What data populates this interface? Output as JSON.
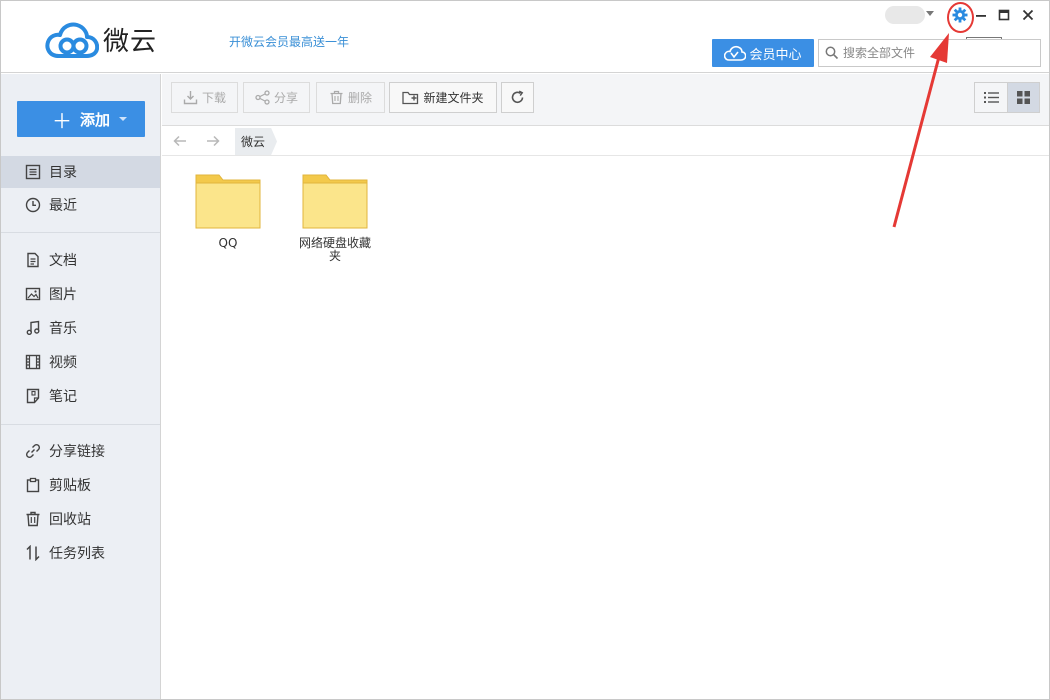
{
  "app": {
    "name": "微云",
    "promo": "开微云会员最高送一年"
  },
  "header": {
    "vip_label": "会员中心",
    "search_placeholder": "搜索全部文件",
    "settings_tooltip": "设置"
  },
  "sidebar": {
    "add_label": "添加",
    "items": [
      {
        "label": "目录",
        "icon": "list-icon",
        "active": true
      },
      {
        "label": "最近",
        "icon": "clock-icon"
      },
      {
        "label": "文档",
        "icon": "document-icon"
      },
      {
        "label": "图片",
        "icon": "image-icon"
      },
      {
        "label": "音乐",
        "icon": "music-icon"
      },
      {
        "label": "视频",
        "icon": "film-icon"
      },
      {
        "label": "笔记",
        "icon": "note-icon"
      },
      {
        "label": "分享链接",
        "icon": "link-icon"
      },
      {
        "label": "剪贴板",
        "icon": "clipboard-icon"
      },
      {
        "label": "回收站",
        "icon": "trash-icon"
      },
      {
        "label": "任务列表",
        "icon": "transfer-icon"
      }
    ]
  },
  "toolbar": {
    "download": "下载",
    "share": "分享",
    "delete": "删除",
    "new_folder": "新建文件夹"
  },
  "breadcrumb": {
    "current": "微云"
  },
  "files": [
    {
      "name": "QQ",
      "type": "folder"
    },
    {
      "name": "网络硬盘收藏夹",
      "type": "folder"
    }
  ],
  "colors": {
    "accent": "#3b8fe4",
    "folder": "#fbe58b",
    "annotation": "#e53935"
  }
}
